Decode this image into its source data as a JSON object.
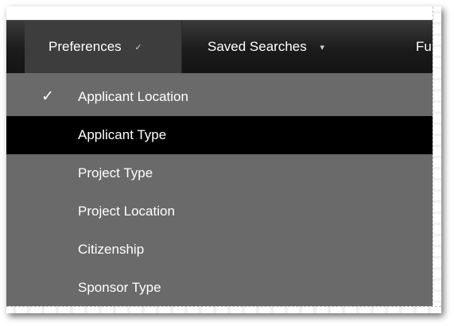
{
  "menubar": {
    "items": [
      {
        "label": "Preferences",
        "caret": "✓",
        "active": true
      },
      {
        "label": "Saved Searches",
        "caret": "▾",
        "active": false
      },
      {
        "label": "Fun",
        "caret": "",
        "active": false
      }
    ]
  },
  "dropdown": {
    "items": [
      {
        "label": "Applicant Location",
        "checked": true,
        "check_mark": "✓",
        "highlighted": false
      },
      {
        "label": "Applicant Type",
        "checked": false,
        "highlighted": true
      },
      {
        "label": "Project Type",
        "checked": false,
        "highlighted": false
      },
      {
        "label": "Project Location",
        "checked": false,
        "highlighted": false
      },
      {
        "label": "Citizenship",
        "checked": false,
        "highlighted": false
      },
      {
        "label": "Sponsor Type",
        "checked": false,
        "highlighted": false
      }
    ]
  },
  "colors": {
    "menubar_bg": "#1b1b1b",
    "active_menu_bg": "#3d3d3d",
    "dropdown_bg": "#6a6a6a",
    "highlight_bg": "#000000",
    "text": "#ffffff"
  }
}
